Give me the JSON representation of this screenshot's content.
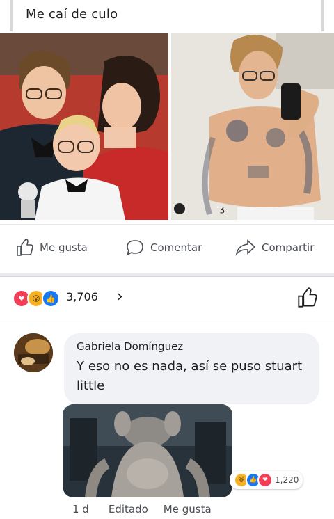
{
  "post": {
    "text": "Me caí de culo"
  },
  "actions": {
    "like": "Me gusta",
    "comment": "Comentar",
    "share": "Compartir"
  },
  "reactions": {
    "count": "3,706",
    "types": [
      "love-icon",
      "wow-icon",
      "like-icon"
    ]
  },
  "comment": {
    "author": "Gabriela Domínguez",
    "text": "Y eso no es nada, así se puso stuart little",
    "reaction_count": "1,220",
    "time": "1 d",
    "edited": "Editado",
    "like": "Me gusta"
  },
  "colors": {
    "like_blue": "#1877f2",
    "love_red": "#f33e58",
    "wow_yellow": "#f7b125"
  }
}
